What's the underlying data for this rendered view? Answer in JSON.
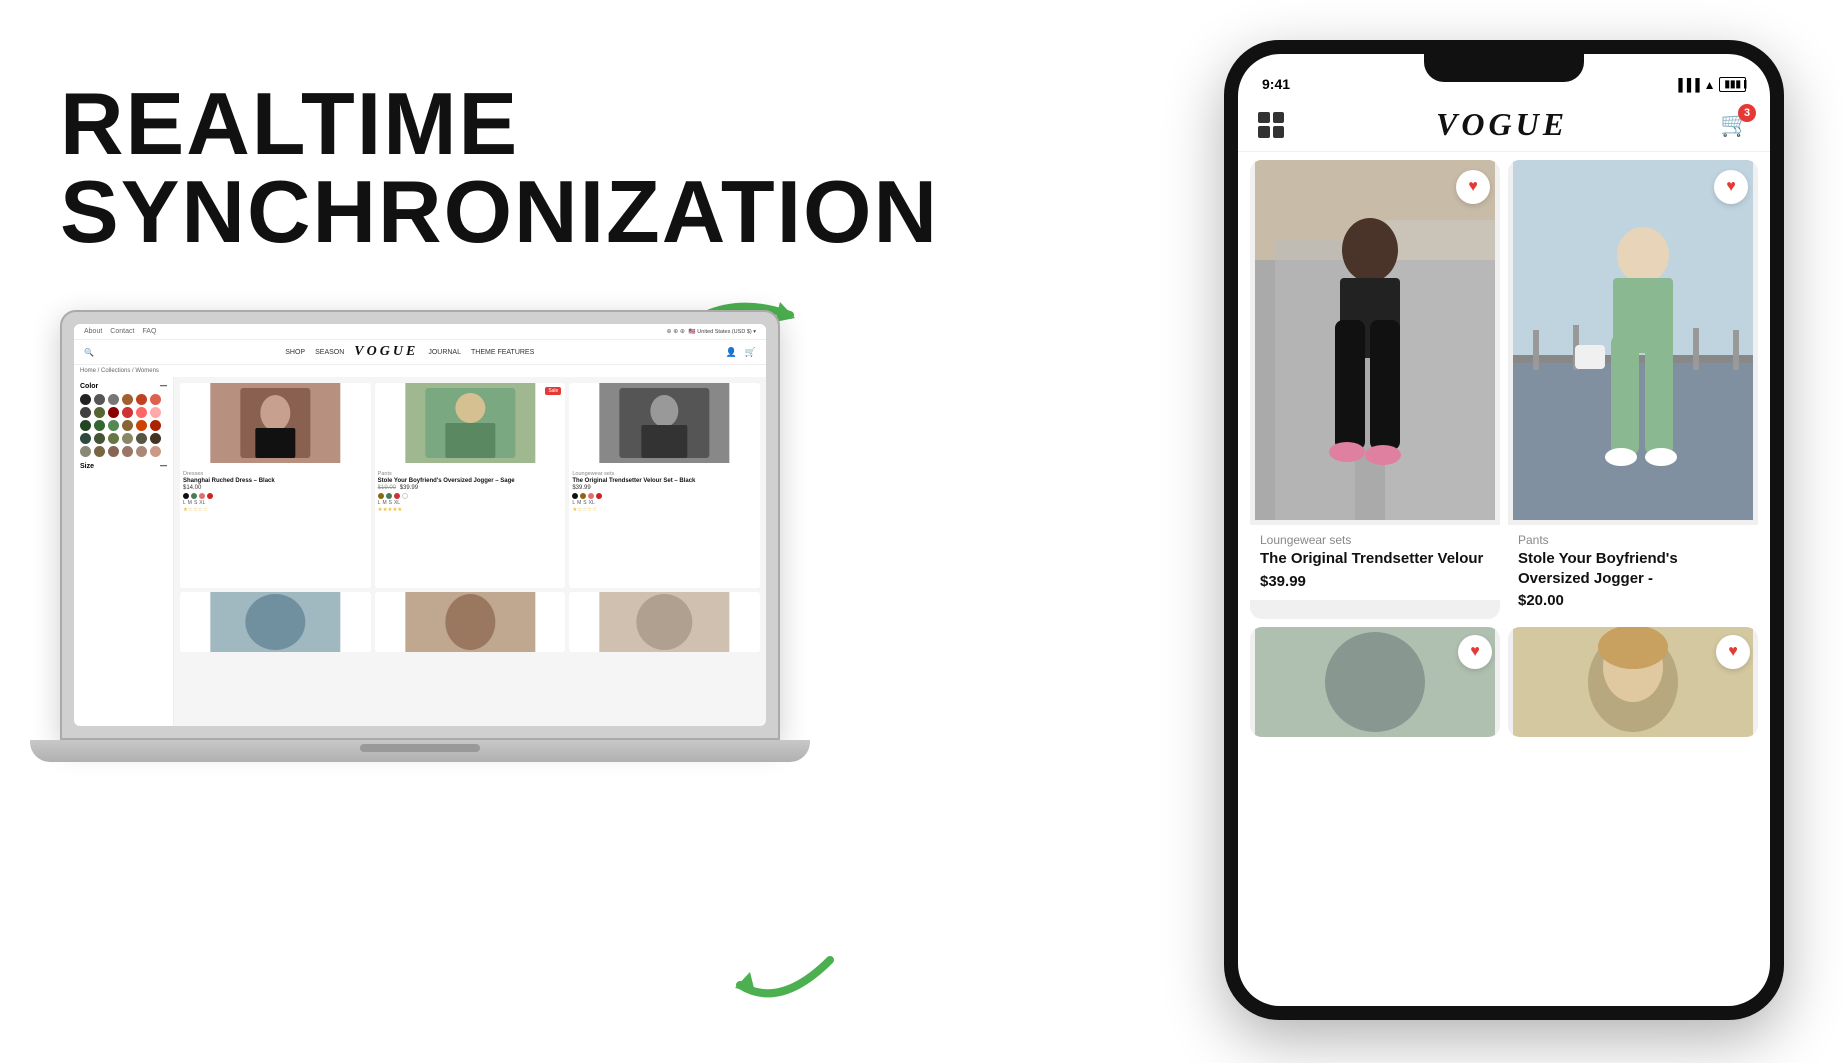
{
  "headline": {
    "line1": "REALTIME",
    "line2": "SYNCHRONIZATION"
  },
  "laptop": {
    "header_links": [
      "About",
      "Contact",
      "FAQ"
    ],
    "nav_links": [
      "SHOP",
      "SEASON",
      "JOURNAL",
      "THEME FEATURES"
    ],
    "logo": "VOGUE",
    "breadcrumb": "Home / Collections / Womens",
    "sidebar": {
      "color_label": "Color",
      "size_label": "Size",
      "swatches": [
        "#222",
        "#555",
        "#888",
        "#a06030",
        "#c04020",
        "#e06050",
        "#404040",
        "#556633",
        "#8b0000",
        "#cc3333",
        "#ff6666",
        "#ffaaaa",
        "#224422",
        "#336633",
        "#558855",
        "#886633",
        "#cc4400",
        "#aa2200",
        "#2d4a3e",
        "#445533",
        "#667744",
        "#888866",
        "#555544",
        "#443322",
        "#666655",
        "#776644",
        "#886655",
        "#997766",
        "#aa8877",
        "#cc9988"
      ]
    },
    "products": [
      {
        "name": "Shanghai Ruched Dress – Black",
        "category": "Dresses",
        "price": "$14.00",
        "colors": [
          "#111",
          "#4a7c59",
          "#e07070",
          "#cc2222"
        ],
        "sizes": [
          "L",
          "M",
          "S",
          "XL"
        ],
        "has_sale": false,
        "stars": 1
      },
      {
        "name": "Stole Your Boyfriend's Oversized Jogger – Sage",
        "category": "Pants",
        "price": "$39.99",
        "original_price": "$19.00",
        "colors": [
          "#8b6914",
          "#4a7c59",
          "#cc3333",
          "#ffffff"
        ],
        "sizes": [
          "L",
          "M",
          "S",
          "XL"
        ],
        "has_sale": true,
        "stars": 5
      },
      {
        "name": "The Original Trendsetter Velour Set – Black",
        "category": "Loungewear sets",
        "price": "$39.99",
        "colors": [
          "#111",
          "#8b6914",
          "#e07070",
          "#cc2222"
        ],
        "sizes": [
          "L",
          "M",
          "S",
          "XL"
        ],
        "has_sale": false,
        "stars": 1
      }
    ]
  },
  "phone": {
    "status_time": "9:41",
    "logo": "VOGUE",
    "cart_count": "3",
    "products": [
      {
        "category": "Loungewear sets",
        "name": "The Original Trendsetter Velour",
        "price": "$39.99",
        "bg_color": "#c0b090"
      },
      {
        "category": "Pants",
        "name": "Stole Your Boyfriend's Oversized Jogger -",
        "price": "$20.00",
        "bg_color": "#a8c4a0"
      }
    ],
    "bottom_products": [
      {
        "bg_color": "#b0c0b8"
      },
      {
        "bg_color": "#d4c4a0"
      }
    ]
  },
  "arrows": {
    "right_arrow_color": "#4caf50",
    "left_arrow_color": "#4caf50"
  }
}
